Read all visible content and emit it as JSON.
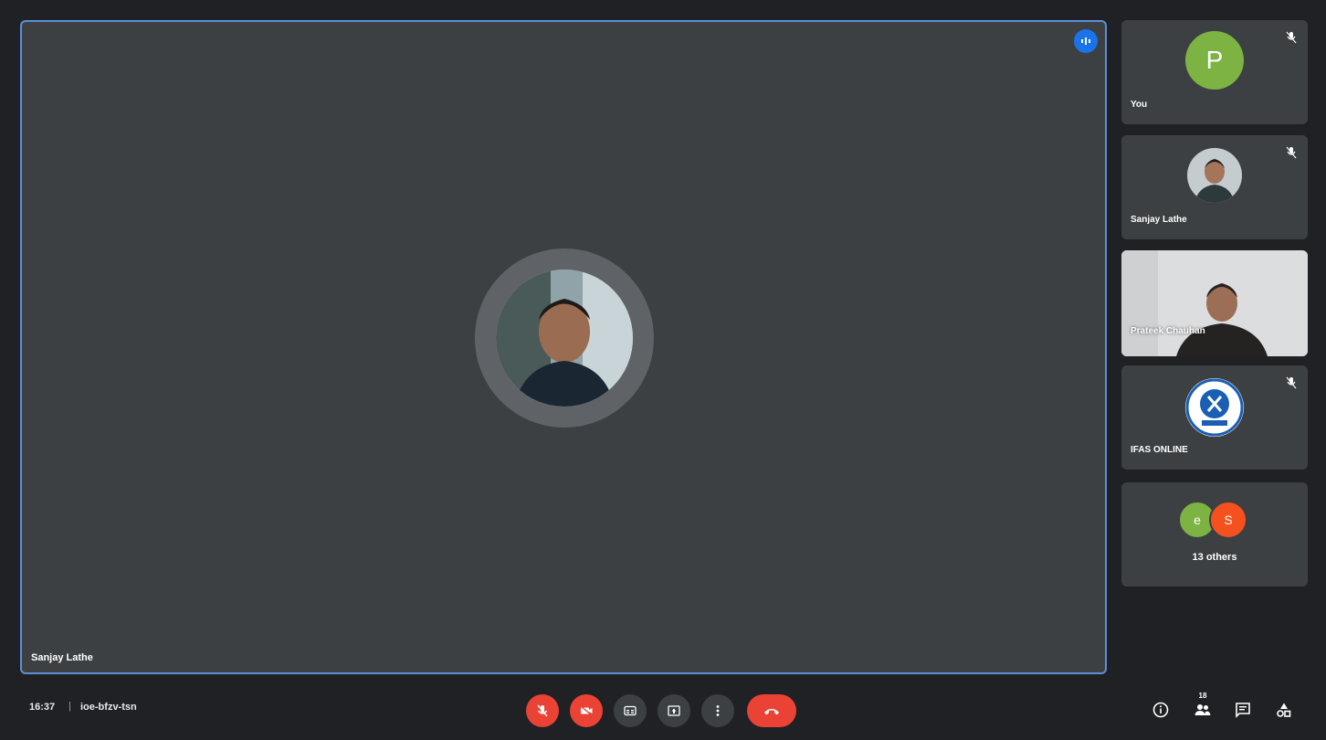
{
  "main": {
    "speaker_name": "Sanjay Lathe",
    "speaking_indicator_icon": "audio-wave-icon"
  },
  "participants": [
    {
      "name": "You",
      "avatar_letter": "P",
      "avatar_color": "#7cb342",
      "mic": "muted"
    },
    {
      "name": "Sanjay Lathe",
      "avatar": "photo",
      "mic": "muted"
    },
    {
      "name": "Prateek Chauhan",
      "video": "on"
    },
    {
      "name": "IFAS ONLINE",
      "avatar": "logo",
      "mic": "muted"
    }
  ],
  "others": {
    "label": "13 others",
    "avatars": [
      {
        "letter": "e",
        "color": "#7cb342"
      },
      {
        "letter": "S",
        "color": "#f4511e"
      }
    ]
  },
  "footer": {
    "time": "16:37",
    "meeting_code": "ioe-bfzv-tsn"
  },
  "controls": {
    "mic_icon": "mic-off-icon",
    "camera_icon": "camera-off-icon",
    "captions_icon": "captions-icon",
    "present_icon": "present-icon",
    "more_icon": "more-options-icon",
    "leave_icon": "end-call-icon"
  },
  "right_icons": [
    "info-icon",
    "people-icon",
    "chat-icon",
    "activities-icon"
  ],
  "participants_count_badge": "18",
  "colors": {
    "background": "#202124",
    "tile": "#3c4043",
    "active_border": "#5b8fd8",
    "danger": "#ea4335",
    "accent": "#1a73e8"
  }
}
